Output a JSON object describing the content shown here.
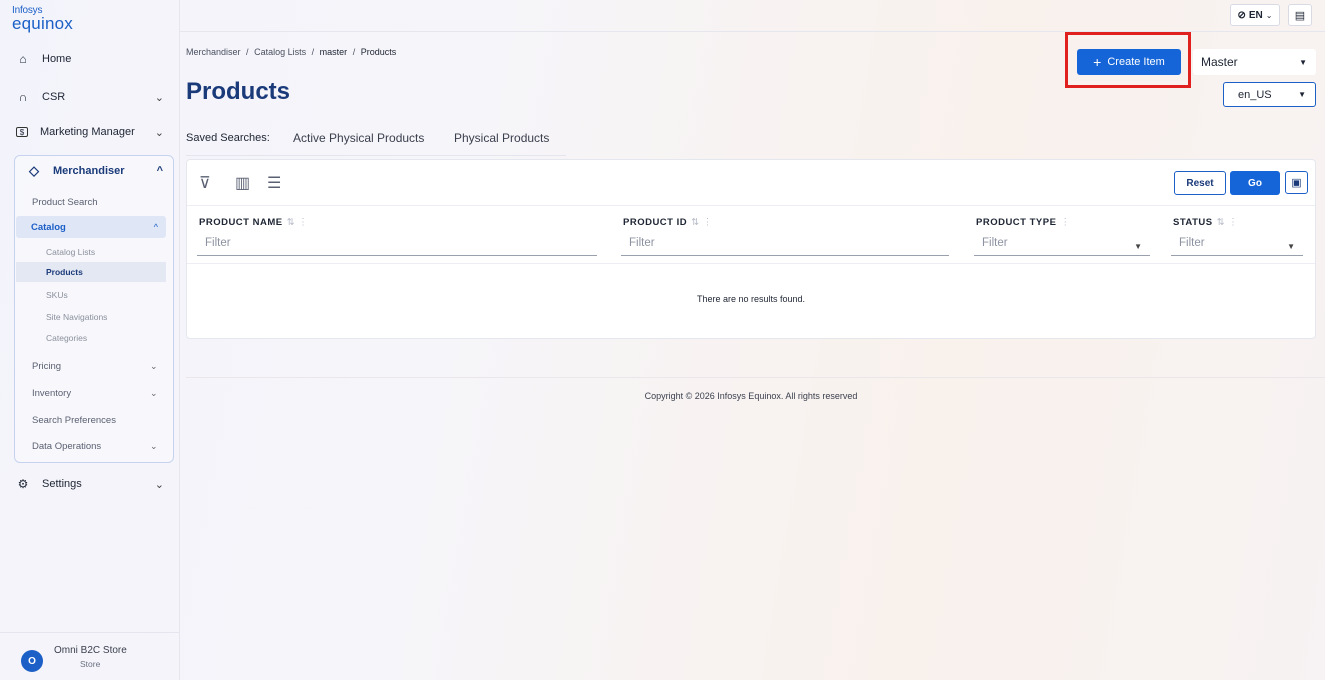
{
  "logo": {
    "line1": "Infosys",
    "line2": "equinox"
  },
  "sidebar": {
    "home": "Home",
    "csr": "CSR",
    "marketing": "Marketing Manager",
    "merchandiser": "Merchandiser",
    "product_search": "Product Search",
    "catalog": "Catalog",
    "catalog_lists": "Catalog Lists",
    "products": "Products",
    "skus": "SKUs",
    "site_navigations": "Site Navigations",
    "categories": "Categories",
    "pricing": "Pricing",
    "inventory": "Inventory",
    "search_preferences": "Search Preferences",
    "data_operations": "Data Operations",
    "settings": "Settings"
  },
  "user": {
    "initial": "O",
    "store_name": "Omni B2C Store",
    "role": "Store"
  },
  "topbar": {
    "language": "EN"
  },
  "breadcrumb": {
    "items": [
      "Merchandiser",
      "Catalog Lists",
      "master",
      "Products"
    ],
    "sep": "/"
  },
  "page": {
    "title": "Products"
  },
  "actions": {
    "create_item": "Create Item",
    "catalog_select": "Master",
    "locale_select": "en_US"
  },
  "saved_searches": {
    "label": "Saved Searches:",
    "items": [
      "Active Physical Products",
      "Physical Products"
    ]
  },
  "table": {
    "reset": "Reset",
    "go": "Go",
    "columns": [
      "PRODUCT NAME",
      "PRODUCT ID",
      "PRODUCT TYPE",
      "STATUS"
    ],
    "filter_placeholder": "Filter",
    "empty_message": "There are no results found."
  },
  "footer": {
    "copyright": "Copyright © 2026 Infosys Equinox. All rights reserved"
  },
  "colors": {
    "primary": "#1565d8",
    "navy": "#1a3a7a",
    "highlight": "#e0201e"
  }
}
